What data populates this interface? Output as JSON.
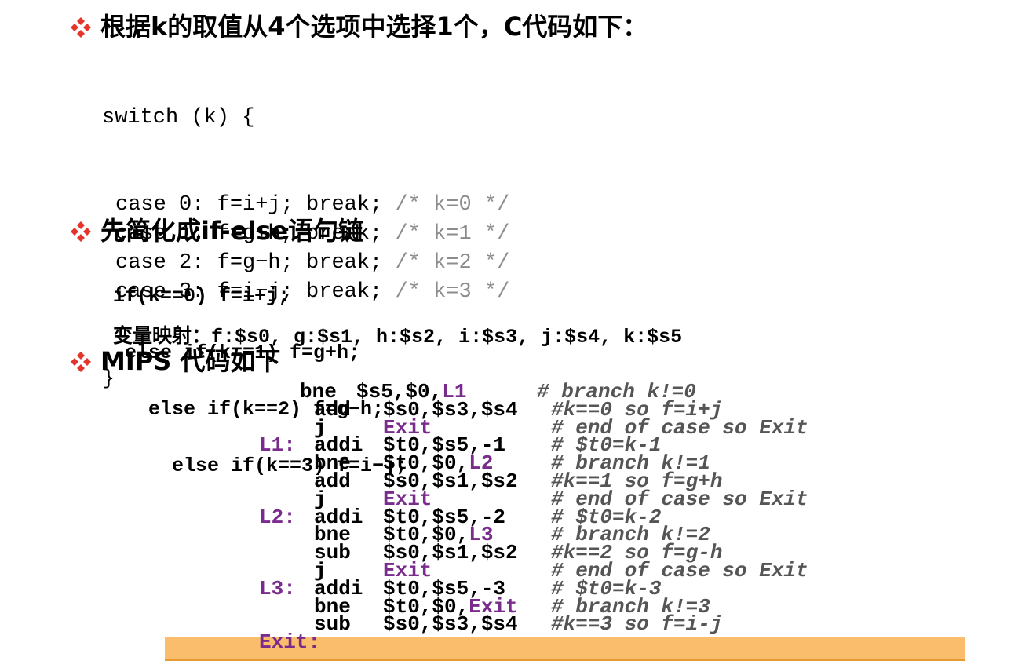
{
  "sections": [
    {
      "heading": "根据k的取值从4个选项中选择1个，C代码如下："
    },
    {
      "heading": "先简化成if-else语句链"
    },
    {
      "heading": "MIPS 代码如下"
    }
  ],
  "c_code": {
    "open": "switch (k) {",
    "cases": [
      {
        "code": "case 0: f=i+j; break; ",
        "comment": "/* k=0 */"
      },
      {
        "code": "case 1: f=g+h; break; ",
        "comment": "/* k=1 */"
      },
      {
        "code": "case 2: f=g−h; break; ",
        "comment": "/* k=2 */"
      },
      {
        "code": "case 3: f=i−j; break; ",
        "comment": "/* k=3 */"
      }
    ],
    "close": "}"
  },
  "if_chain": [
    "if(k==0) f=i+j;",
    " else if(k==1) f=g+h;",
    "   else if(k==2) f=g−h;",
    "     else if(k==3) f=i−j;"
  ],
  "mapping": {
    "label": "变量映射：",
    "text": "f:$s0, g:$s1, h:$s2, i:$s3, j:$s4, k:$s5"
  },
  "mips": [
    {
      "label": "",
      "op": "bne",
      "args": "$s5,$0,",
      "target": "L1",
      "comment": "# branch k!=0"
    },
    {
      "label": "",
      "op": "add",
      "args": "$s0,$s3,$s4",
      "target": "",
      "comment": "#k==0 so f=i+j"
    },
    {
      "label": "",
      "op": "j",
      "args": "",
      "target": "Exit",
      "comment": "# end of case so Exit"
    },
    {
      "label": "L1:",
      "op": "addi",
      "args": "$t0,$s5,-1",
      "target": "",
      "comment": "# $t0=k-1"
    },
    {
      "label": "",
      "op": "bne",
      "args": "$t0,$0,",
      "target": "L2",
      "comment": "# branch k!=1"
    },
    {
      "label": "",
      "op": "add",
      "args": "$s0,$s1,$s2",
      "target": "",
      "comment": "#k==1 so f=g+h"
    },
    {
      "label": "",
      "op": "j",
      "args": "",
      "target": "Exit",
      "comment": "# end of case so Exit"
    },
    {
      "label": "L2:",
      "op": "addi",
      "args": "$t0,$s5,-2",
      "target": "",
      "comment": "# $t0=k-2"
    },
    {
      "label": "",
      "op": "bne",
      "args": "$t0,$0,",
      "target": "L3",
      "comment": "# branch k!=2"
    },
    {
      "label": "",
      "op": "sub",
      "args": "$s0,$s1,$s2",
      "target": "",
      "comment": "#k==2 so f=g-h"
    },
    {
      "label": "",
      "op": "j",
      "args": "",
      "target": "Exit",
      "comment": "# end of case so Exit"
    },
    {
      "label": "L3:",
      "op": "addi",
      "args": "$t0,$s5,-3",
      "target": "",
      "comment": "# $t0=k-3"
    },
    {
      "label": "",
      "op": "bne",
      "args": "$t0,$0,",
      "target": "Exit",
      "comment": "# branch k!=3"
    },
    {
      "label": "",
      "op": "sub",
      "args": "$s0,$s3,$s4",
      "target": "",
      "comment": "#k==3 so f=i-j"
    },
    {
      "label": "Exit:",
      "op": "",
      "args": "",
      "target": "",
      "comment": ""
    }
  ],
  "colors": {
    "bullet": "#e4342c",
    "comment_gray": "#8c8c8c",
    "label_purple": "#7a2c8c",
    "highlight_bar": "#f9bd6b"
  },
  "icons": {
    "bullet": "four-diamond-bullet-icon"
  }
}
